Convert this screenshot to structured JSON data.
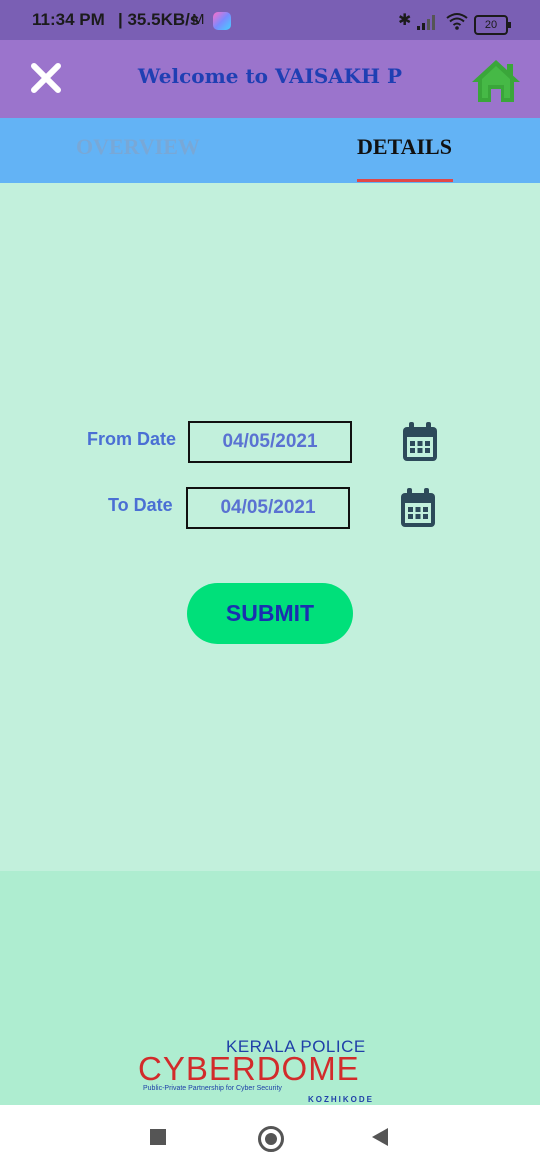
{
  "status_bar": {
    "time": "11:34 PM",
    "speed": "| 35.5KB/s",
    "gmail_glyph": "M",
    "battery": "20"
  },
  "app_bar": {
    "title": "Welcome to VAISAKH P",
    "close_icon": "close-icon",
    "home_icon": "home-icon",
    "home_color": "#3aa63a"
  },
  "tabs": [
    {
      "label": "OVERVIEW",
      "selected": false
    },
    {
      "label": "DETAILS",
      "selected": true
    }
  ],
  "form": {
    "from_label": "From Date",
    "from_value": "04/05/2021",
    "to_label": "To Date",
    "to_value": "04/05/2021",
    "calendar_icon": "calendar-icon",
    "submit_label": "SUBMIT"
  },
  "footer_logo": {
    "top": "KERALA POLICE",
    "main": "CYBERDOME",
    "sub": "Public-Private Partnership for Cyber Security",
    "location": "KOZHIKODE"
  },
  "colors": {
    "status_bar": "#7a5fb4",
    "app_bar": "#9b74cc",
    "tab_bar": "#63b3f5",
    "content_bg": "#c2f0dc",
    "footer_bg": "#aeedd0",
    "submit_bg": "#00e07a",
    "tab_indicator": "#e04848"
  }
}
